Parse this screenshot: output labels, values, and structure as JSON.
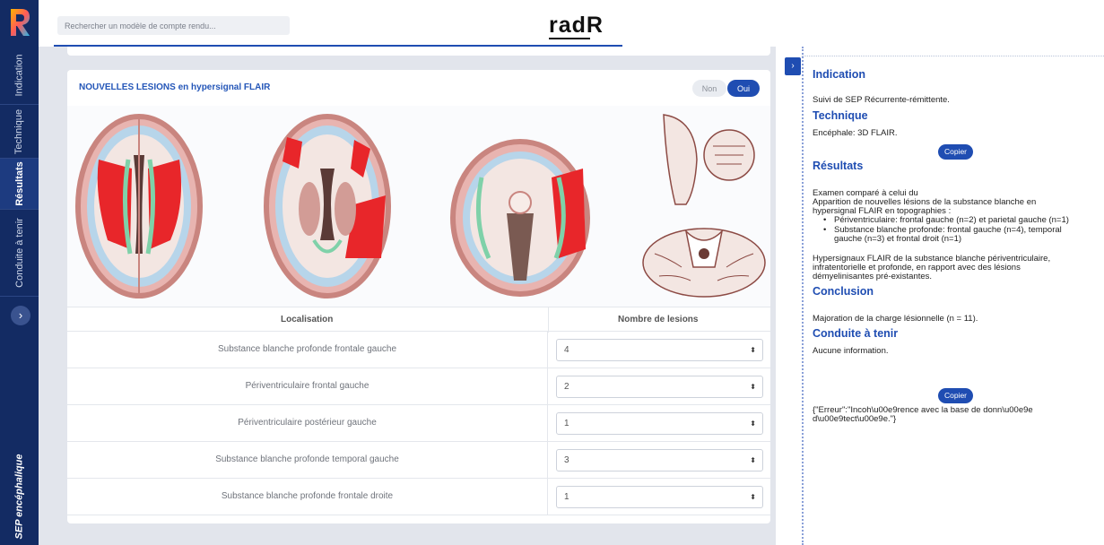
{
  "sidebar": {
    "tabs": [
      {
        "label": "Indication"
      },
      {
        "label": "Technique"
      },
      {
        "label": "Résultats"
      },
      {
        "label": "Conduite à tenir"
      }
    ],
    "footer": "SEP encéphalique",
    "expand_icon": "chevron-right-icon"
  },
  "header": {
    "search_placeholder": "Rechercher un modèle de compte rendu...",
    "brand": "radR"
  },
  "card": {
    "title": "NOUVELLES LESIONS en hypersignal FLAIR",
    "toggle_no": "Non",
    "toggle_yes": "Oui",
    "table": {
      "col_location": "Localisation",
      "col_count": "Nombre de lesions",
      "rows": [
        {
          "location": "Substance blanche profonde frontale gauche",
          "value": "4"
        },
        {
          "location": "Périventriculaire frontal gauche",
          "value": "2"
        },
        {
          "location": "Périventriculaire postérieur gauche",
          "value": "1"
        },
        {
          "location": "Substance blanche profonde temporal gauche",
          "value": "3"
        },
        {
          "location": "Substance blanche profonde frontale droite",
          "value": "1"
        }
      ]
    }
  },
  "report": {
    "indication_title": "Indication",
    "indication_text": "Suivi de SEP Récurrente-rémittente.",
    "technique_title": "Technique",
    "technique_text": "Encéphale: 3D FLAIR.",
    "copy_label": "Copier",
    "results_title": "Résultats",
    "results_line1": "Examen comparé à celui du",
    "results_line2": "Apparition de nouvelles lésions de la substance blanche en",
    "results_line3": "hypersignal FLAIR en topographies :",
    "bullet1_line1": "Périventriculaire: frontal gauche (n=2) et parietal gauche (n=1)",
    "bullet2_line1": "Substance blanche profonde: frontal gauche (n=4), temporal",
    "bullet2_line2": "gauche (n=3) et frontal droit (n=1)",
    "results_para_line1": "Hypersignaux FLAIR de la substance blanche périventriculaire,",
    "results_para_line2": "infratentorielle et profonde, en rapport avec des lésions",
    "results_para_line3": "démyelinisantes pré-existantes.",
    "conclusion_title": "Conclusion",
    "conclusion_text": "Majoration de la charge lésionnelle (n = 11).",
    "conduite_title": "Conduite à tenir",
    "conduite_text": "Aucune information.",
    "copy_label_2": "Copier",
    "error_line1": "{\"Erreur\":\"Incoh\\u00e9rence avec la base de donn\\u00e9e",
    "error_line2": "d\\u00e9tect\\u00e9e.\"}"
  },
  "colors": {
    "nav_bg": "#132b63",
    "accent": "#1f4db2",
    "lesion": "#e8262a"
  }
}
